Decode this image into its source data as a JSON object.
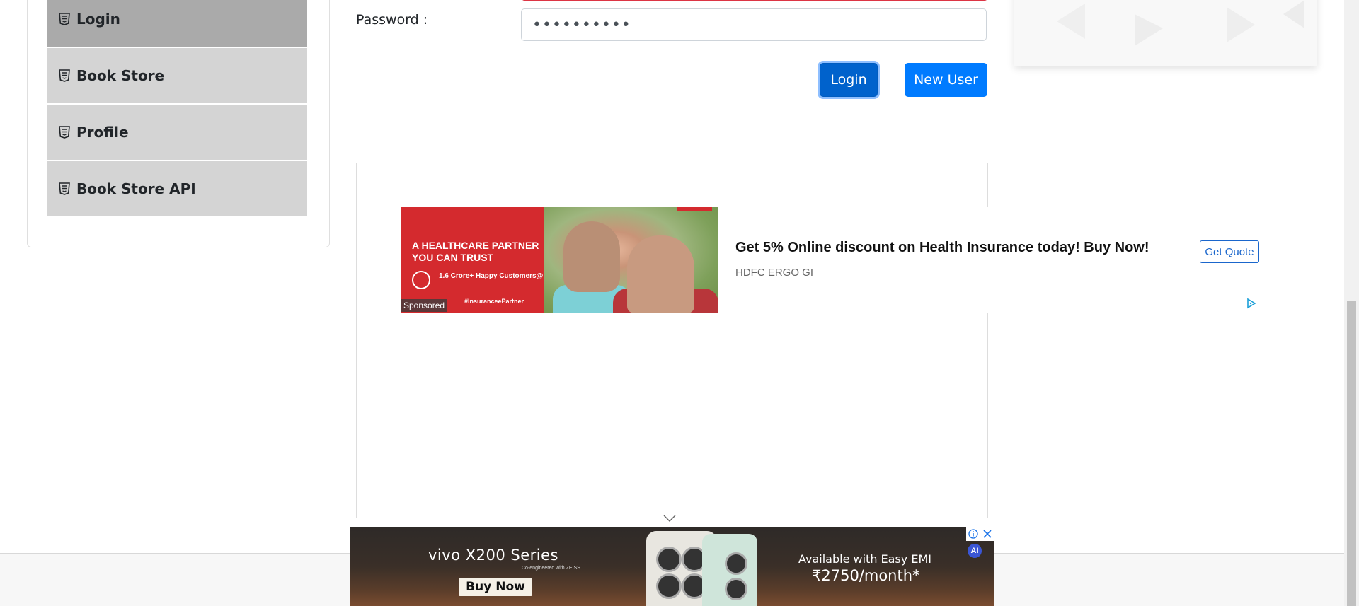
{
  "sidebar": {
    "items": [
      {
        "label": "Login",
        "icon": "html5-icon",
        "active": true
      },
      {
        "label": "Book Store",
        "icon": "html5-icon",
        "active": false
      },
      {
        "label": "Profile",
        "icon": "html5-icon",
        "active": false
      },
      {
        "label": "Book Store API",
        "icon": "html5-icon",
        "active": false
      }
    ]
  },
  "login_form": {
    "password_label": "Password :",
    "password_value": "••••••••••",
    "login_button": "Login",
    "new_user_button": "New User"
  },
  "sponsored_ad": {
    "image_headline": "A HEALTHCARE PARTNER YOU CAN TRUST",
    "image_customers": "1.6 Crore+ Happy Customers@",
    "image_partner_tag": "#InsuranceePartner",
    "sponsored_label": "Sponsored",
    "title": "Get 5% Online discount on Health Insurance today! Buy Now!",
    "advertiser": "HDFC ERGO GI",
    "cta": "Get Quote"
  },
  "bottom_ad": {
    "brand": "vivo X200 Series",
    "tagline": "Co-engineered with ZEISS",
    "buy_button": "Buy Now",
    "emi_text": "Available with Easy EMI",
    "price": "₹2750/month*",
    "ai_badge": "AI"
  },
  "colors": {
    "primary": "#007bff",
    "primary_active": "#0062cc",
    "sidebar_item": "#d4d4d4",
    "sidebar_active": "#aaaaaa",
    "error": "#dc3545"
  }
}
